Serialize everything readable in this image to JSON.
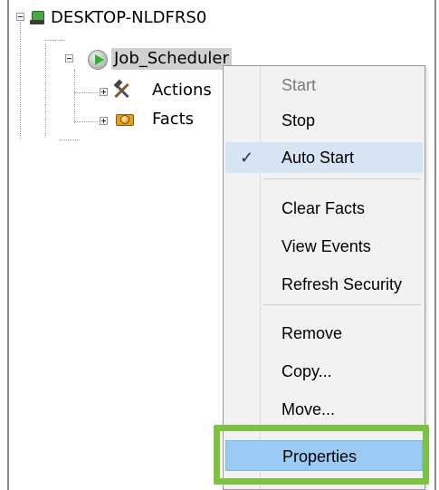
{
  "tree": {
    "root": {
      "label": "DESKTOP-NLDFRS0",
      "icon": "computer-icon"
    },
    "service": {
      "label": "Job_Scheduler",
      "icon": "service-running-icon"
    },
    "children": [
      {
        "label": "Actions",
        "icon": "tools-icon"
      },
      {
        "label": "Facts",
        "icon": "facts-icon"
      }
    ]
  },
  "context_menu": {
    "items": [
      {
        "label": "Start",
        "enabled": false,
        "checked": false
      },
      {
        "label": "Stop",
        "enabled": true,
        "checked": false
      },
      {
        "label": "Auto Start",
        "enabled": true,
        "checked": true
      },
      {
        "label": "Clear Facts",
        "enabled": true,
        "checked": false
      },
      {
        "label": "View Events",
        "enabled": true,
        "checked": false
      },
      {
        "label": "Refresh Security",
        "enabled": true,
        "checked": false
      },
      {
        "label": "Remove",
        "enabled": true,
        "checked": false
      },
      {
        "label": "Copy...",
        "enabled": true,
        "checked": false
      },
      {
        "label": "Move...",
        "enabled": true,
        "checked": false
      },
      {
        "label": "Properties",
        "enabled": true,
        "checked": false,
        "highlighted": true
      }
    ],
    "check_glyph": "✓"
  },
  "colors": {
    "highlight": "#9bcbf5",
    "focus_outline": "#7cc242",
    "checked_row": "#d6e4f3"
  }
}
